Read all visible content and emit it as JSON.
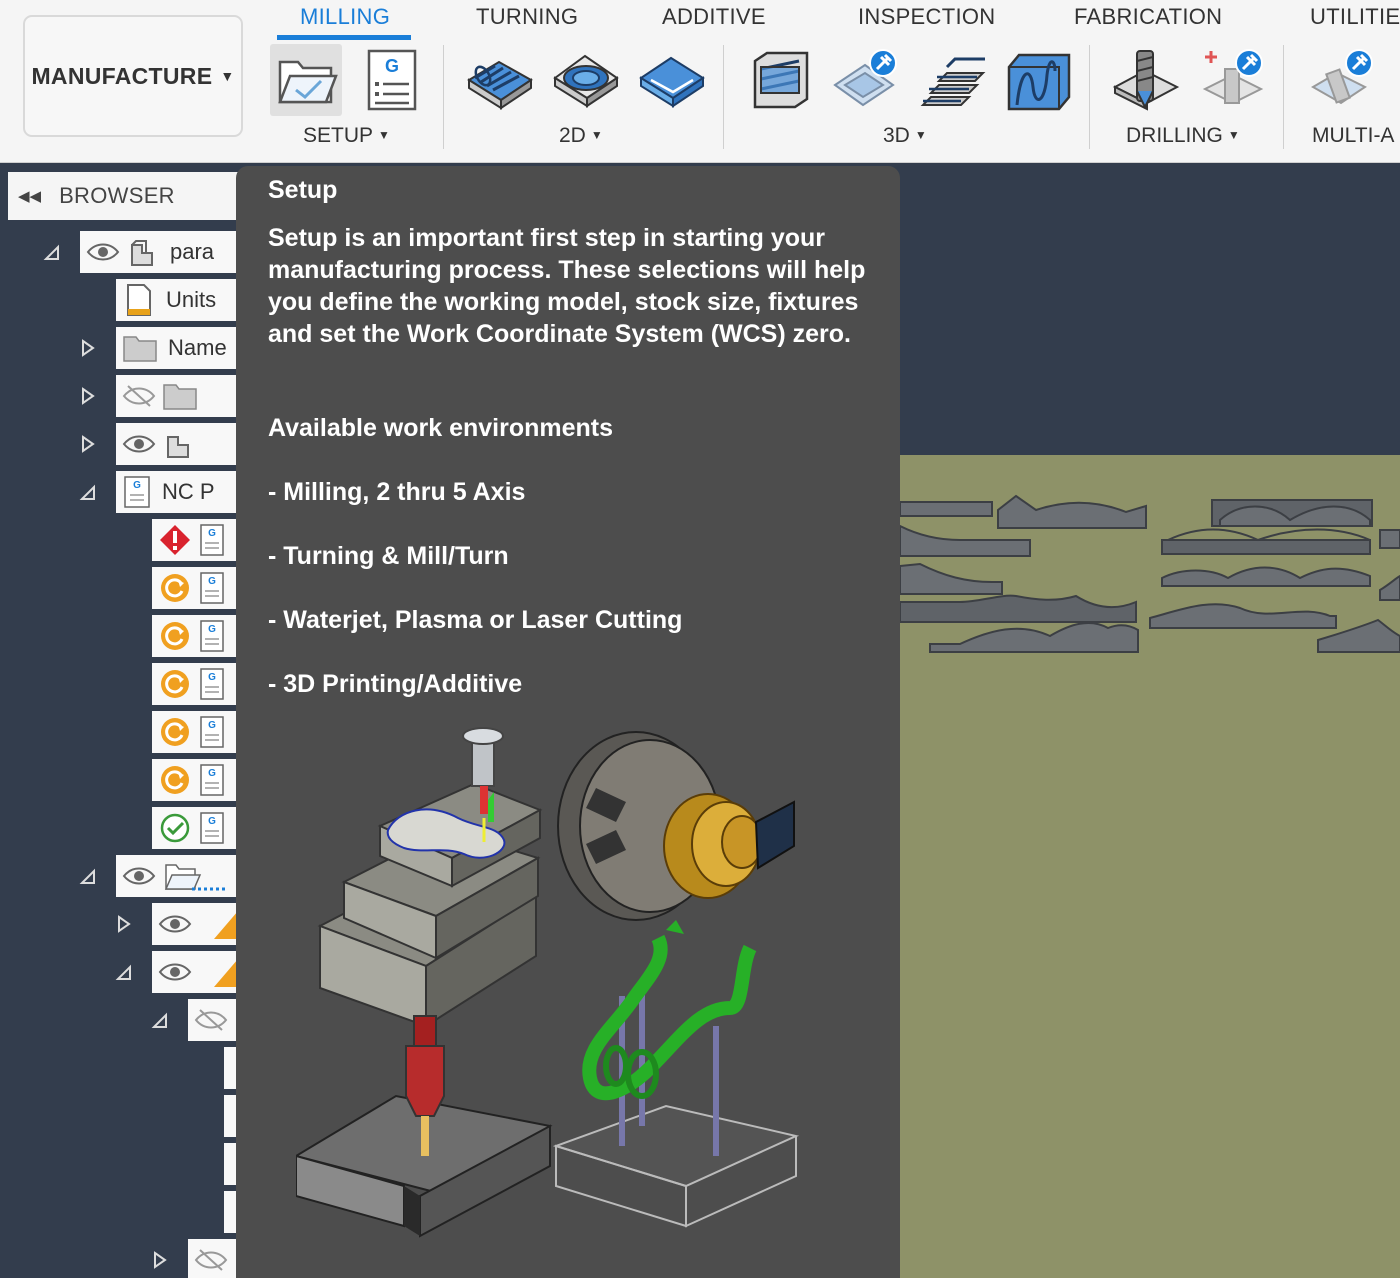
{
  "toolbar": {
    "workspace": "MANUFACTURE",
    "tabs": [
      "MILLING",
      "TURNING",
      "ADDITIVE",
      "INSPECTION",
      "FABRICATION",
      "UTILITIES"
    ],
    "active_tab": "MILLING",
    "groups": [
      "SETUP",
      "2D",
      "3D",
      "DRILLING",
      "MULTI-A"
    ]
  },
  "browser": {
    "title": "BROWSER",
    "nodes": [
      "para",
      "Units",
      "Name",
      "NC P"
    ]
  },
  "tooltip": {
    "title": "Setup",
    "description": "Setup is an important first step in starting your manufacturing process. These selections will help you define the working model, stock size, fixtures and set the Work Coordinate System (WCS) zero.",
    "environments_heading": "Available work environments",
    "environments": [
      "- Milling, 2 thru 5 Axis",
      "- Turning & Mill/Turn",
      "- Waterjet, Plasma or Laser Cutting",
      "- 3D Printing/Additive"
    ]
  },
  "colors": {
    "accent": "#1a7ed8",
    "canvas": "#333d4d",
    "model": "#8e9268",
    "tooltip_bg": "#4d4d4d"
  }
}
